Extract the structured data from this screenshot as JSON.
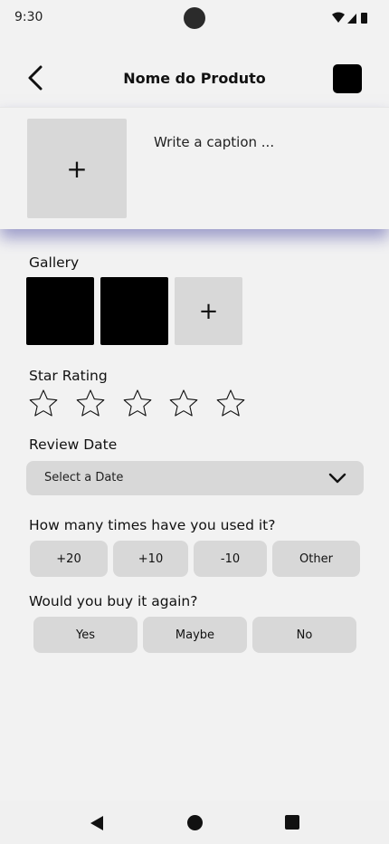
{
  "status_bar": {
    "time": "9:30"
  },
  "header": {
    "title": "Nome do Produto"
  },
  "caption": {
    "add_symbol": "+",
    "placeholder": "Write a caption ..."
  },
  "gallery": {
    "label": "Gallery",
    "add_symbol": "+",
    "thumbnail_count": 2
  },
  "rating": {
    "label": "Star Rating",
    "value": 0,
    "max": 5
  },
  "review_date": {
    "label": "Review Date",
    "placeholder": "Select a Date"
  },
  "usage": {
    "label": "How many times have you used it?",
    "options": [
      "+20",
      "+10",
      "-10",
      "Other"
    ]
  },
  "buy_again": {
    "label": "Would you buy it again?",
    "options": [
      "Yes",
      "Maybe",
      "No"
    ]
  },
  "icons": {
    "back": "arrow-left-icon",
    "action": "square-icon",
    "star": "star-outline-icon",
    "dropdown": "chevron-down-icon",
    "nav_back": "triangle-back-icon",
    "nav_home": "circle-home-icon",
    "nav_recents": "square-recents-icon"
  },
  "colors": {
    "background": "#f2f2f2",
    "control": "#d8d8d8",
    "accent_shadow": "#5a5aaa",
    "text": "#111111"
  }
}
